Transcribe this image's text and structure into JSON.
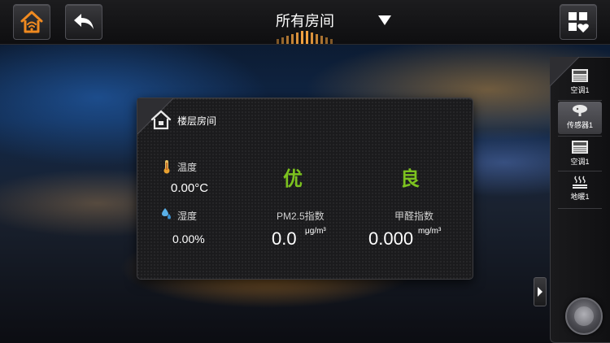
{
  "header": {
    "title": "所有房间"
  },
  "room": {
    "name": "楼层房间"
  },
  "sensors": {
    "temperature": {
      "label": "温度",
      "value": "0.00°C"
    },
    "humidity": {
      "label": "湿度",
      "value": "0.00%"
    },
    "pm25": {
      "grade": "优",
      "label": "PM2.5指数",
      "value": "0.0",
      "unit": "μg/m³"
    },
    "formaldehyde": {
      "grade": "良",
      "label": "甲醛指数",
      "value": "0.000",
      "unit": "mg/m³"
    }
  },
  "sidebar": {
    "items": [
      {
        "label": "空调1",
        "icon": "air-conditioner-icon",
        "active": false
      },
      {
        "label": "传感器1",
        "icon": "sensor-icon",
        "active": true
      },
      {
        "label": "空调1",
        "icon": "air-conditioner-icon",
        "active": false
      },
      {
        "label": "地暖1",
        "icon": "floor-heating-icon",
        "active": false
      }
    ]
  },
  "colors": {
    "accent_orange": "#f08a20",
    "grade_green": "#7cc21f"
  }
}
